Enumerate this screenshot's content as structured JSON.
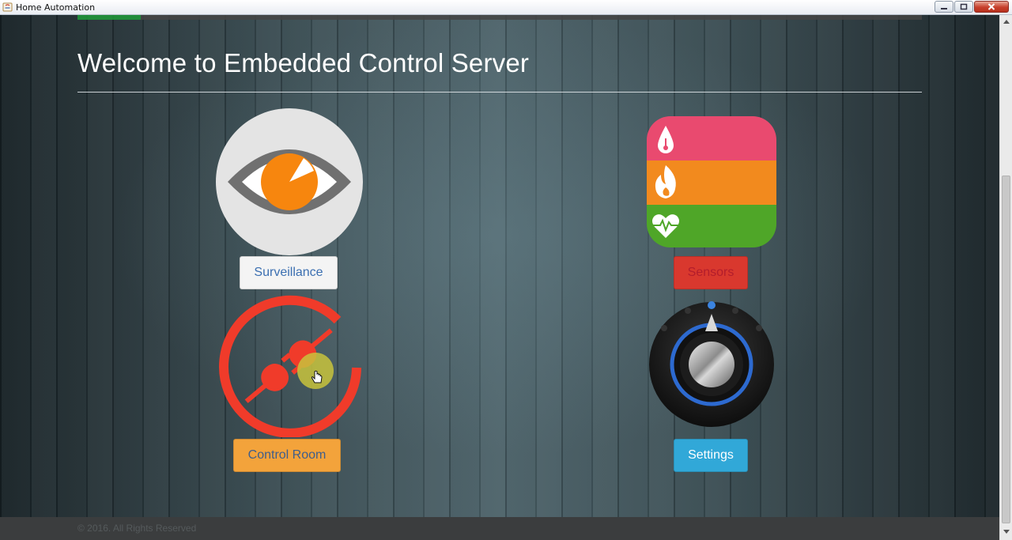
{
  "window": {
    "title": "Home Automation"
  },
  "page": {
    "title": "Welcome to Embedded Control Server",
    "footer": "© 2016. All Rights Reserved"
  },
  "tiles": {
    "surveillance": {
      "label": "Surveillance",
      "icon": "eye-icon"
    },
    "sensors": {
      "label": "Sensors",
      "icon": "sensors-icon"
    },
    "control_room": {
      "label": "Control Room",
      "icon": "plug-icon"
    },
    "settings": {
      "label": "Settings",
      "icon": "knob-icon"
    }
  },
  "colors": {
    "surveillance_button": "#f4f4f4",
    "sensors_button": "#d9382e",
    "control_room_button": "#f3a33b",
    "settings_button": "#31a8d8",
    "sensor_band_top": "#e94a6f",
    "sensor_band_mid": "#f28a1e",
    "sensor_band_bottom": "#4fa628",
    "plug_red": "#f03b2a",
    "eye_orange": "#f7860e"
  }
}
